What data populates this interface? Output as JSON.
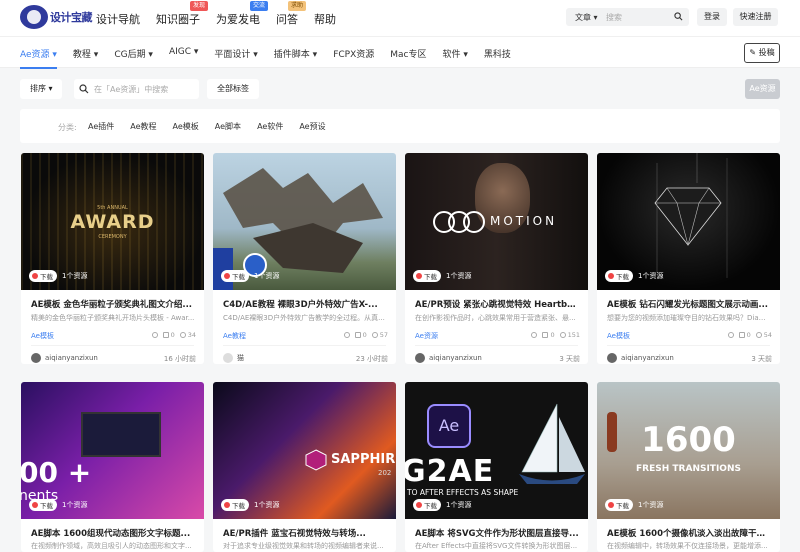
{
  "logo": {
    "text": "设计宝藏"
  },
  "nav": [
    {
      "label": "设计导航",
      "badge": "",
      "badge_color": ""
    },
    {
      "label": "知识圈子",
      "badge": "发现",
      "badge_color": "red"
    },
    {
      "label": "为爱发电",
      "badge": "交流",
      "badge_color": "blue"
    },
    {
      "label": "问答",
      "badge": "求助",
      "badge_color": "gold"
    },
    {
      "label": "帮助",
      "badge": "",
      "badge_color": ""
    }
  ],
  "search": {
    "type_label": "文章 ▾",
    "placeholder": "搜索"
  },
  "auth": {
    "login": "登录",
    "register": "快速注册"
  },
  "categories": [
    "Ae资源 ▾",
    "教程 ▾",
    "CG后期 ▾",
    "AIGC ▾",
    "平面设计 ▾",
    "插件脚本 ▾",
    "FCPX资源",
    "Mac专区",
    "软件 ▾",
    "黑科技"
  ],
  "post_button": "✎ 投稿",
  "filter": {
    "sort": "排序 ▾",
    "search_placeholder": "在「Ae资源」中搜索",
    "all_tags": "全部标签",
    "right_btn": "Ae资源"
  },
  "classify": {
    "label": "分类:",
    "items": [
      "Ae插件",
      "Ae教程",
      "Ae模板",
      "Ae脚本",
      "Ae软件",
      "Ae预设"
    ]
  },
  "colors": {
    "accent": "#3b7ef0",
    "download_dot": "#ef4444"
  },
  "cards": [
    {
      "badge": "下载",
      "res": "1个资源",
      "title": "AE模板 金色华丽粒子颁奖典礼图文介绍...",
      "desc": "精美的金色华丽粒子颁奖典礼开场片头模板 - Awar...",
      "tag": "Ae模板",
      "views": "",
      "comments": "0",
      "likes": "34",
      "author": "aiqianyanzixun",
      "time": "16 小时前",
      "thumb_text": "AWARD",
      "thumb_sub": "5th ANNUAL",
      "thumb_sub2": "CEREMONY"
    },
    {
      "badge": "下载",
      "res": "1个资源",
      "title": "C4D/AE教程 裸眼3D户外特效广告X-...",
      "desc": "C4D/AE裸眼3D户外特效广告教学的全过程。从真...",
      "tag": "Ae教程",
      "views": "",
      "comments": "0",
      "likes": "57",
      "author": "猫",
      "time": "23 小时前",
      "thumb_text": "",
      "thumb_sub": "",
      "thumb_sub2": ""
    },
    {
      "badge": "下载",
      "res": "1个资源",
      "title": "AE/PR预设 紧张心跳视觉特效 Heartbeat...",
      "desc": "在创作影视作品时，心跳效果常用于营造紧张、悬...",
      "tag": "Ae资源",
      "views": "",
      "comments": "0",
      "likes": "151",
      "author": "aiqianyanzixun",
      "time": "3 天前",
      "thumb_text": "MOTION",
      "thumb_sub": "",
      "thumb_sub2": ""
    },
    {
      "badge": "下载",
      "res": "1个资源",
      "title": "AE模板 钻石闪耀发光标题图文展示动画...",
      "desc": "想要为您的视频添加璀璨夺目的钻石效果吗？Diam...",
      "tag": "Ae模板",
      "views": "",
      "comments": "0",
      "likes": "54",
      "author": "aiqianyanzixun",
      "time": "3 天前",
      "thumb_text": "",
      "thumb_sub": "",
      "thumb_sub2": ""
    },
    {
      "badge": "下载",
      "res": "1个资源",
      "title": "AE脚本 1600组现代动态图形文字标题...",
      "desc": "在视频制作领域，高效且吸引人的动态图形和文字...",
      "tag": "",
      "views": "",
      "comments": "",
      "likes": "",
      "author": "",
      "time": "",
      "thumb_text": "00 +",
      "thumb_sub": "nents",
      "thumb_sub2": ""
    },
    {
      "badge": "下载",
      "res": "1个资源",
      "title": "AE/PR插件 蓝宝石视觉特效与转场...",
      "desc": "对于追求专业级视觉效果和转场的视频编辑者来说...",
      "tag": "",
      "views": "",
      "comments": "",
      "likes": "",
      "author": "",
      "time": "",
      "thumb_text": "SAPPHIR",
      "thumb_sub": "202",
      "thumb_sub2": ""
    },
    {
      "badge": "下载",
      "res": "1个资源",
      "title": "AE脚本 将SVG文件作为形状图层直接导...",
      "desc": "在After Effects中直接将SVG文件转换为形状图层...",
      "tag": "",
      "views": "",
      "comments": "",
      "likes": "",
      "author": "",
      "time": "",
      "thumb_text": "G2AE",
      "thumb_sub": "TO AFTER EFFECTS AS SHAPE",
      "thumb_sub2": "Ae"
    },
    {
      "badge": "下载",
      "res": "1个资源",
      "title": "AE模板 1600个摄像机淡入淡出故障干扰...",
      "desc": "在视频编辑中，转场效果不仅连接场景，更能增添...",
      "tag": "",
      "views": "",
      "comments": "",
      "likes": "",
      "author": "",
      "time": "",
      "thumb_text": "1600",
      "thumb_sub": "FRESH TRANSITIONS",
      "thumb_sub2": ""
    }
  ]
}
